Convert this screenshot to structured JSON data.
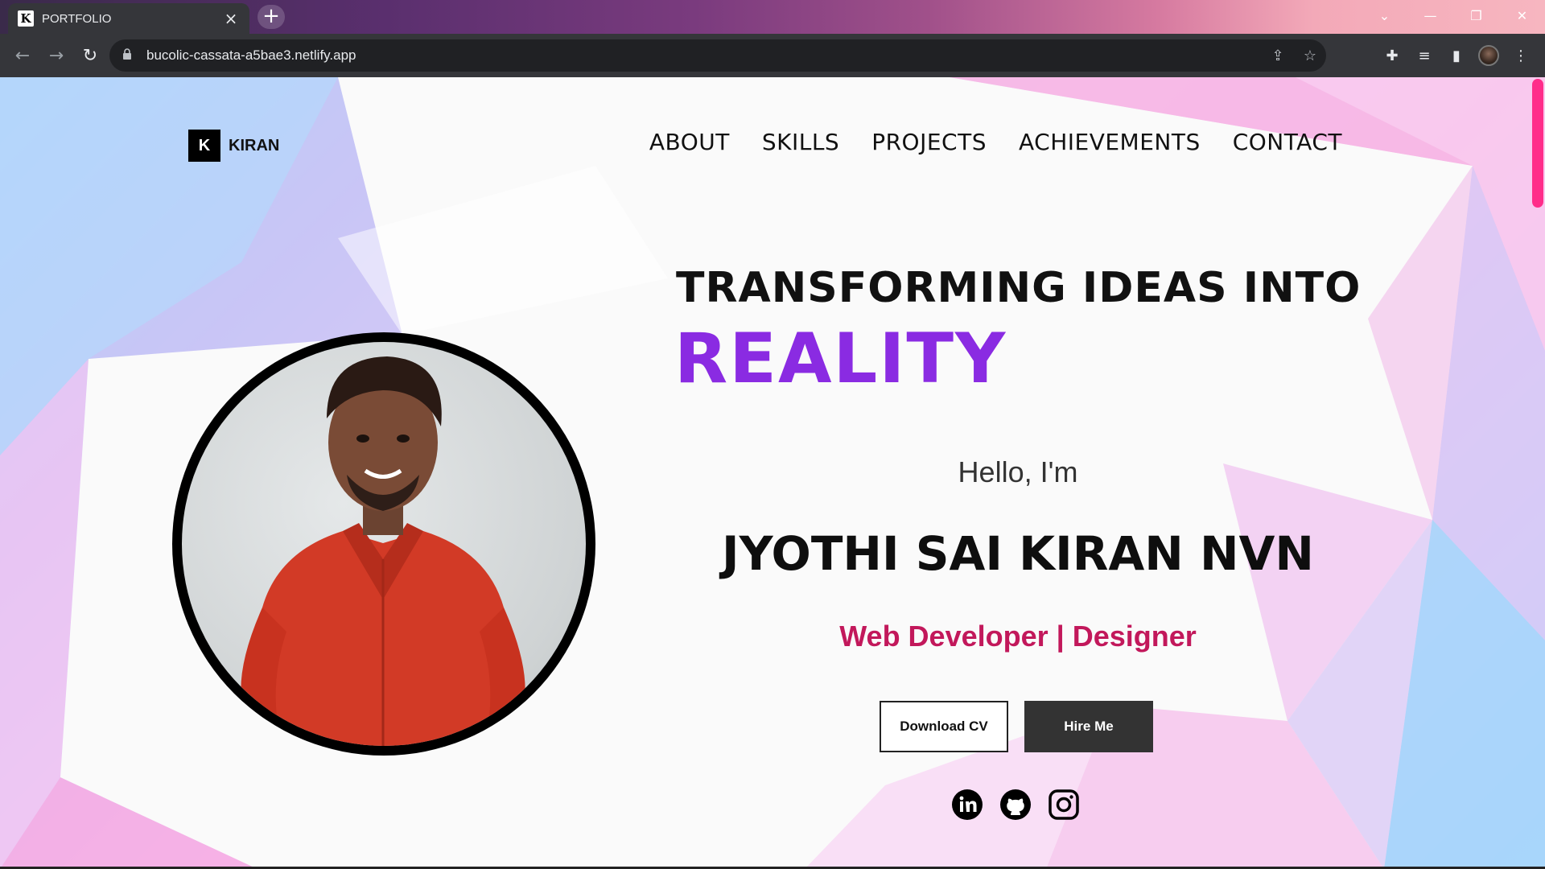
{
  "browser": {
    "tab_title": "PORTFOLIO",
    "tab_favicon_letter": "K",
    "url": "bucolic-cassata-a5bae3.netlify.app",
    "icons": [
      "back-icon",
      "forward-icon",
      "reload-icon",
      "lock-icon",
      "share-icon",
      "star-icon",
      "extensions-icon",
      "media-icon",
      "sidepanel-icon",
      "profile-avatar",
      "menu-icon"
    ]
  },
  "site": {
    "logo_letter": "K",
    "logo_text": "KIRAN",
    "nav": [
      "ABOUT",
      "SKILLS",
      "PROJECTS",
      "ACHIEVEMENTS",
      "CONTACT"
    ],
    "headline": "TRANSFORMING IDEAS INTO",
    "headline_accent": "REALITY",
    "greeting": "Hello, I'm",
    "name": "JYOTHI SAI KIRAN NVN",
    "role": "Web Developer | Designer",
    "buttons": {
      "download_cv": "Download CV",
      "hire_me": "Hire Me"
    },
    "socials": [
      "linkedin-icon",
      "github-icon",
      "instagram-icon"
    ],
    "colors": {
      "accent": "#8a2be2",
      "role": "#c2185b",
      "scroll_thumb": "#ff2d8a"
    }
  }
}
